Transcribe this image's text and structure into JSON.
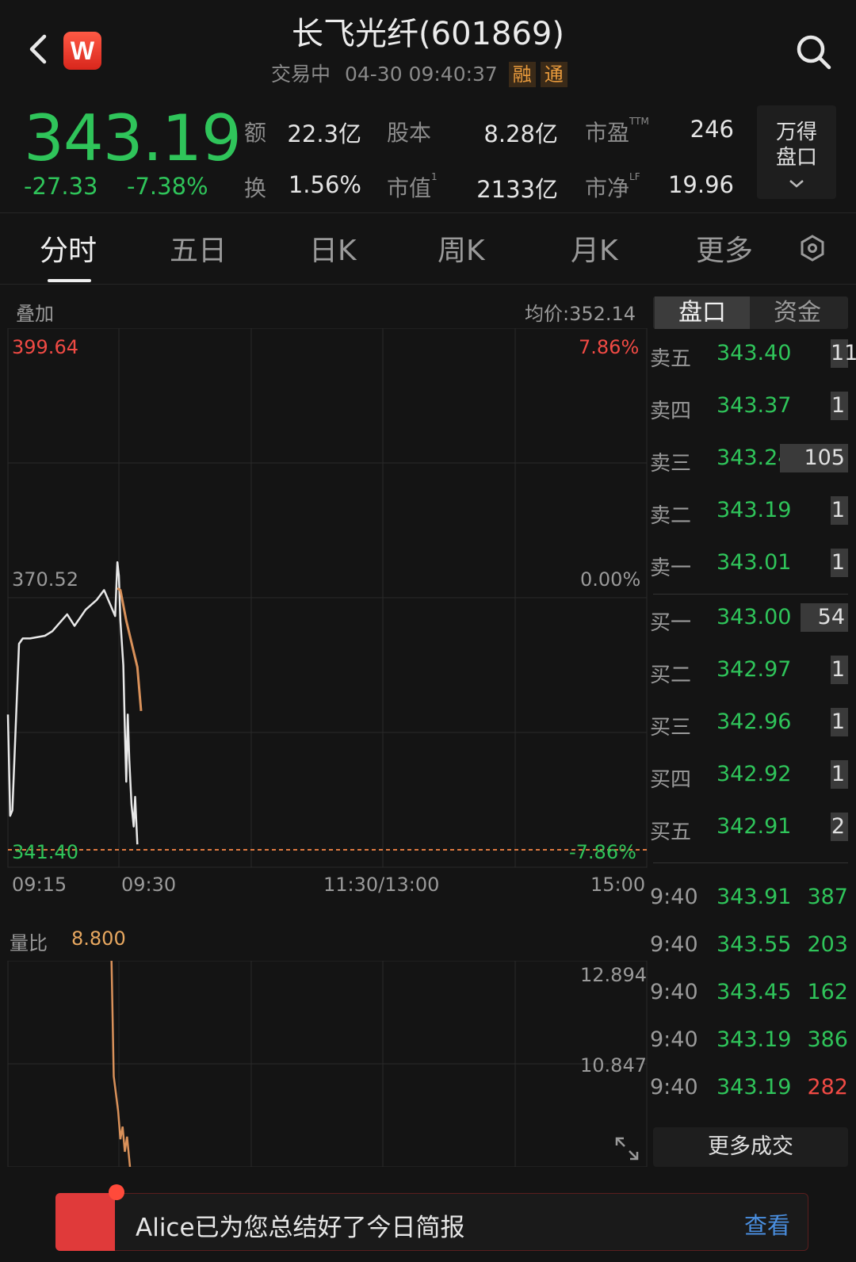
{
  "header": {
    "title": "长飞光纤(601869)",
    "status": "交易中",
    "datetime": "04-30 09:40:37",
    "tags": [
      "融",
      "通"
    ],
    "logo_letter": "W"
  },
  "quote": {
    "price": "343.19",
    "change": "-27.33",
    "change_pct": "-7.38%",
    "stats": [
      {
        "label": "额",
        "value": "22.3亿"
      },
      {
        "label": "股本",
        "value": "8.28亿"
      },
      {
        "label": "市盈",
        "sup": "TTM",
        "value": "246"
      },
      {
        "label": "换",
        "value": "1.56%"
      },
      {
        "label": "市值",
        "sup": "1",
        "value": "2133亿"
      },
      {
        "label": "市净",
        "sup": "LF",
        "value": "19.96"
      }
    ],
    "wind_btn_line1": "万得",
    "wind_btn_line2": "盘口"
  },
  "tabs": [
    "分时",
    "五日",
    "日K",
    "周K",
    "月K",
    "更多"
  ],
  "chart": {
    "overlay_label": "叠加",
    "avg_price_label": "均价:352.14",
    "y_top": "399.64",
    "y_mid": "370.52",
    "y_bot": "341.40",
    "pct_top": "7.86%",
    "pct_mid": "0.00%",
    "pct_bot": "-7.86%",
    "x_labels": [
      "09:15",
      "09:30",
      "11:30/13:00",
      "15:00"
    ],
    "volume_ratio_label": "量比",
    "volume_ratio_value": "8.800",
    "vr_top": "12.894",
    "vr_mid": "10.847"
  },
  "chart_data": {
    "type": "line",
    "title": "",
    "ylim": [
      341.4,
      399.64
    ],
    "x_axis": [
      "09:15",
      "09:30",
      "11:30/13:00",
      "15:00"
    ],
    "series": [
      {
        "name": "",
        "color": "#e8e8e8",
        "values": [
          [
            0,
            356.5
          ],
          [
            0.3,
            345.2
          ],
          [
            0.6,
            345.8
          ],
          [
            1.5,
            364.4
          ],
          [
            2.0,
            365.0
          ],
          [
            3.0,
            365.0
          ],
          [
            5.0,
            365.3
          ],
          [
            6.0,
            365.8
          ],
          [
            8.0,
            367.7
          ],
          [
            9.0,
            366.4
          ],
          [
            10.5,
            368.2
          ],
          [
            12.0,
            369.3
          ],
          [
            13.0,
            370.4
          ],
          [
            14.5,
            367.5
          ],
          [
            14.8,
            373.5
          ],
          [
            15.0,
            372.0
          ],
          [
            15.2,
            367.0
          ],
          [
            15.6,
            362.0
          ],
          [
            15.8,
            355.0
          ],
          [
            16.0,
            349.0
          ],
          [
            16.2,
            356.5
          ],
          [
            16.4,
            351.5
          ],
          [
            16.7,
            346.5
          ],
          [
            17.0,
            344.0
          ],
          [
            17.2,
            347.3
          ],
          [
            17.5,
            342.0
          ]
        ]
      },
      {
        "name": "",
        "color": "#d9915a",
        "values": [
          [
            14.8,
            370.6
          ],
          [
            15.2,
            370.4
          ],
          [
            16.0,
            367.0
          ],
          [
            16.8,
            364.2
          ],
          [
            17.5,
            361.8
          ],
          [
            18.0,
            356.9
          ]
        ]
      }
    ],
    "reference_line": 341.4,
    "volume_ratio": {
      "ylim": [
        8.8,
        12.894
      ],
      "values": [
        [
          14.0,
          12.894
        ],
        [
          14.3,
          10.6
        ],
        [
          14.9,
          9.9
        ],
        [
          15.2,
          9.35
        ],
        [
          15.5,
          9.6
        ],
        [
          15.8,
          9.1
        ],
        [
          16.1,
          9.4
        ],
        [
          16.5,
          8.8
        ]
      ]
    }
  },
  "order_book": {
    "tabs": [
      "盘口",
      "资金"
    ],
    "asks": [
      {
        "label": "卖五",
        "price": "343.40",
        "vol": "11",
        "bar": 0.24
      },
      {
        "label": "卖四",
        "price": "343.37",
        "vol": "1",
        "bar": 0.03
      },
      {
        "label": "卖三",
        "price": "343.24",
        "vol": "105",
        "bar": 1.0
      },
      {
        "label": "卖二",
        "price": "343.19",
        "vol": "1",
        "bar": 0.03
      },
      {
        "label": "卖一",
        "price": "343.01",
        "vol": "1",
        "bar": 0.03
      }
    ],
    "bids": [
      {
        "label": "买一",
        "price": "343.00",
        "vol": "54",
        "bar": 0.7
      },
      {
        "label": "买二",
        "price": "342.97",
        "vol": "1",
        "bar": 0.03
      },
      {
        "label": "买三",
        "price": "342.96",
        "vol": "1",
        "bar": 0.03
      },
      {
        "label": "买四",
        "price": "342.92",
        "vol": "1",
        "bar": 0.03
      },
      {
        "label": "买五",
        "price": "342.91",
        "vol": "2",
        "bar": 0.05
      }
    ]
  },
  "trades": {
    "rows": [
      {
        "time": "9:40",
        "price": "343.91",
        "vol": "387",
        "vol_color": "#2fc45a"
      },
      {
        "time": "9:40",
        "price": "343.55",
        "vol": "203",
        "vol_color": "#2fc45a"
      },
      {
        "time": "9:40",
        "price": "343.45",
        "vol": "162",
        "vol_color": "#2fc45a"
      },
      {
        "time": "9:40",
        "price": "343.19",
        "vol": "386",
        "vol_color": "#2fc45a"
      },
      {
        "time": "9:40",
        "price": "343.19",
        "vol": "282",
        "vol_color": "#f04a44"
      }
    ],
    "more_label": "更多成交"
  },
  "banner": {
    "text": "Alice已为您总结好了今日简报",
    "button": "查看"
  },
  "colors": {
    "up": "#f04a44",
    "down": "#2fc45a",
    "accent": "#e89a3c",
    "link": "#4a8fe0"
  }
}
